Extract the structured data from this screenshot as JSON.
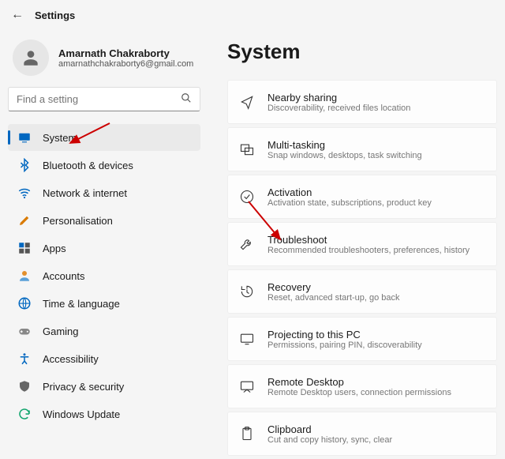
{
  "header": {
    "title": "Settings"
  },
  "profile": {
    "name": "Amarnath Chakraborty",
    "email": "amarnathchakraborty6@gmail.com"
  },
  "search": {
    "placeholder": "Find a setting"
  },
  "sidebar": {
    "items": [
      {
        "label": "System"
      },
      {
        "label": "Bluetooth & devices"
      },
      {
        "label": "Network & internet"
      },
      {
        "label": "Personalisation"
      },
      {
        "label": "Apps"
      },
      {
        "label": "Accounts"
      },
      {
        "label": "Time & language"
      },
      {
        "label": "Gaming"
      },
      {
        "label": "Accessibility"
      },
      {
        "label": "Privacy & security"
      },
      {
        "label": "Windows Update"
      }
    ]
  },
  "page": {
    "title": "System"
  },
  "cards": [
    {
      "title": "Nearby sharing",
      "sub": "Discoverability, received files location"
    },
    {
      "title": "Multi-tasking",
      "sub": "Snap windows, desktops, task switching"
    },
    {
      "title": "Activation",
      "sub": "Activation state, subscriptions, product key"
    },
    {
      "title": "Troubleshoot",
      "sub": "Recommended troubleshooters, preferences, history"
    },
    {
      "title": "Recovery",
      "sub": "Reset, advanced start-up, go back"
    },
    {
      "title": "Projecting to this PC",
      "sub": "Permissions, pairing PIN, discoverability"
    },
    {
      "title": "Remote Desktop",
      "sub": "Remote Desktop users, connection permissions"
    },
    {
      "title": "Clipboard",
      "sub": "Cut and copy history, sync, clear"
    }
  ]
}
